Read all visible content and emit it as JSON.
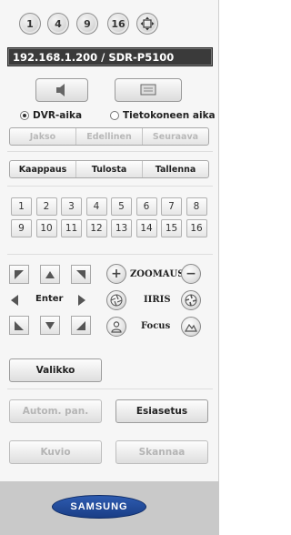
{
  "layout_buttons": [
    "1",
    "4",
    "9",
    "16"
  ],
  "title_bar": {
    "text": "192.168.1.200 / SDR-P5100"
  },
  "source": {
    "options": [
      "DVR-aika",
      "Tietokoneen aika"
    ],
    "selected": "DVR-aika"
  },
  "playback": {
    "items": [
      "Jakso",
      "Edellinen",
      "Seuraava"
    ],
    "enabled": false
  },
  "capture": {
    "items": [
      "Kaappaus",
      "Tulosta",
      "Tallenna"
    ],
    "enabled": true
  },
  "channels": [
    "1",
    "2",
    "3",
    "4",
    "5",
    "6",
    "7",
    "8",
    "9",
    "10",
    "11",
    "12",
    "13",
    "14",
    "15",
    "16"
  ],
  "ptz": {
    "enter_label": "Enter",
    "zoom_label": "ZOOMAUS",
    "iris_label": "IIRIS",
    "focus_label": "Focus"
  },
  "menu_button": "Valikko",
  "auto_pan_button": "Autom. pan.",
  "preset_button": "Esiasetus",
  "pattern_button": "Kuvio",
  "scan_button": "Skannaa",
  "brand": "SAMSUNG",
  "colors": {
    "title_bg": "#3a3a3a",
    "logo_blue": "#2d5bb0",
    "footer": "#c9c9c9"
  },
  "icons": {
    "fullscreen": "fullscreen-icon",
    "audio": "speaker-icon",
    "osd": "monitor-icon"
  }
}
